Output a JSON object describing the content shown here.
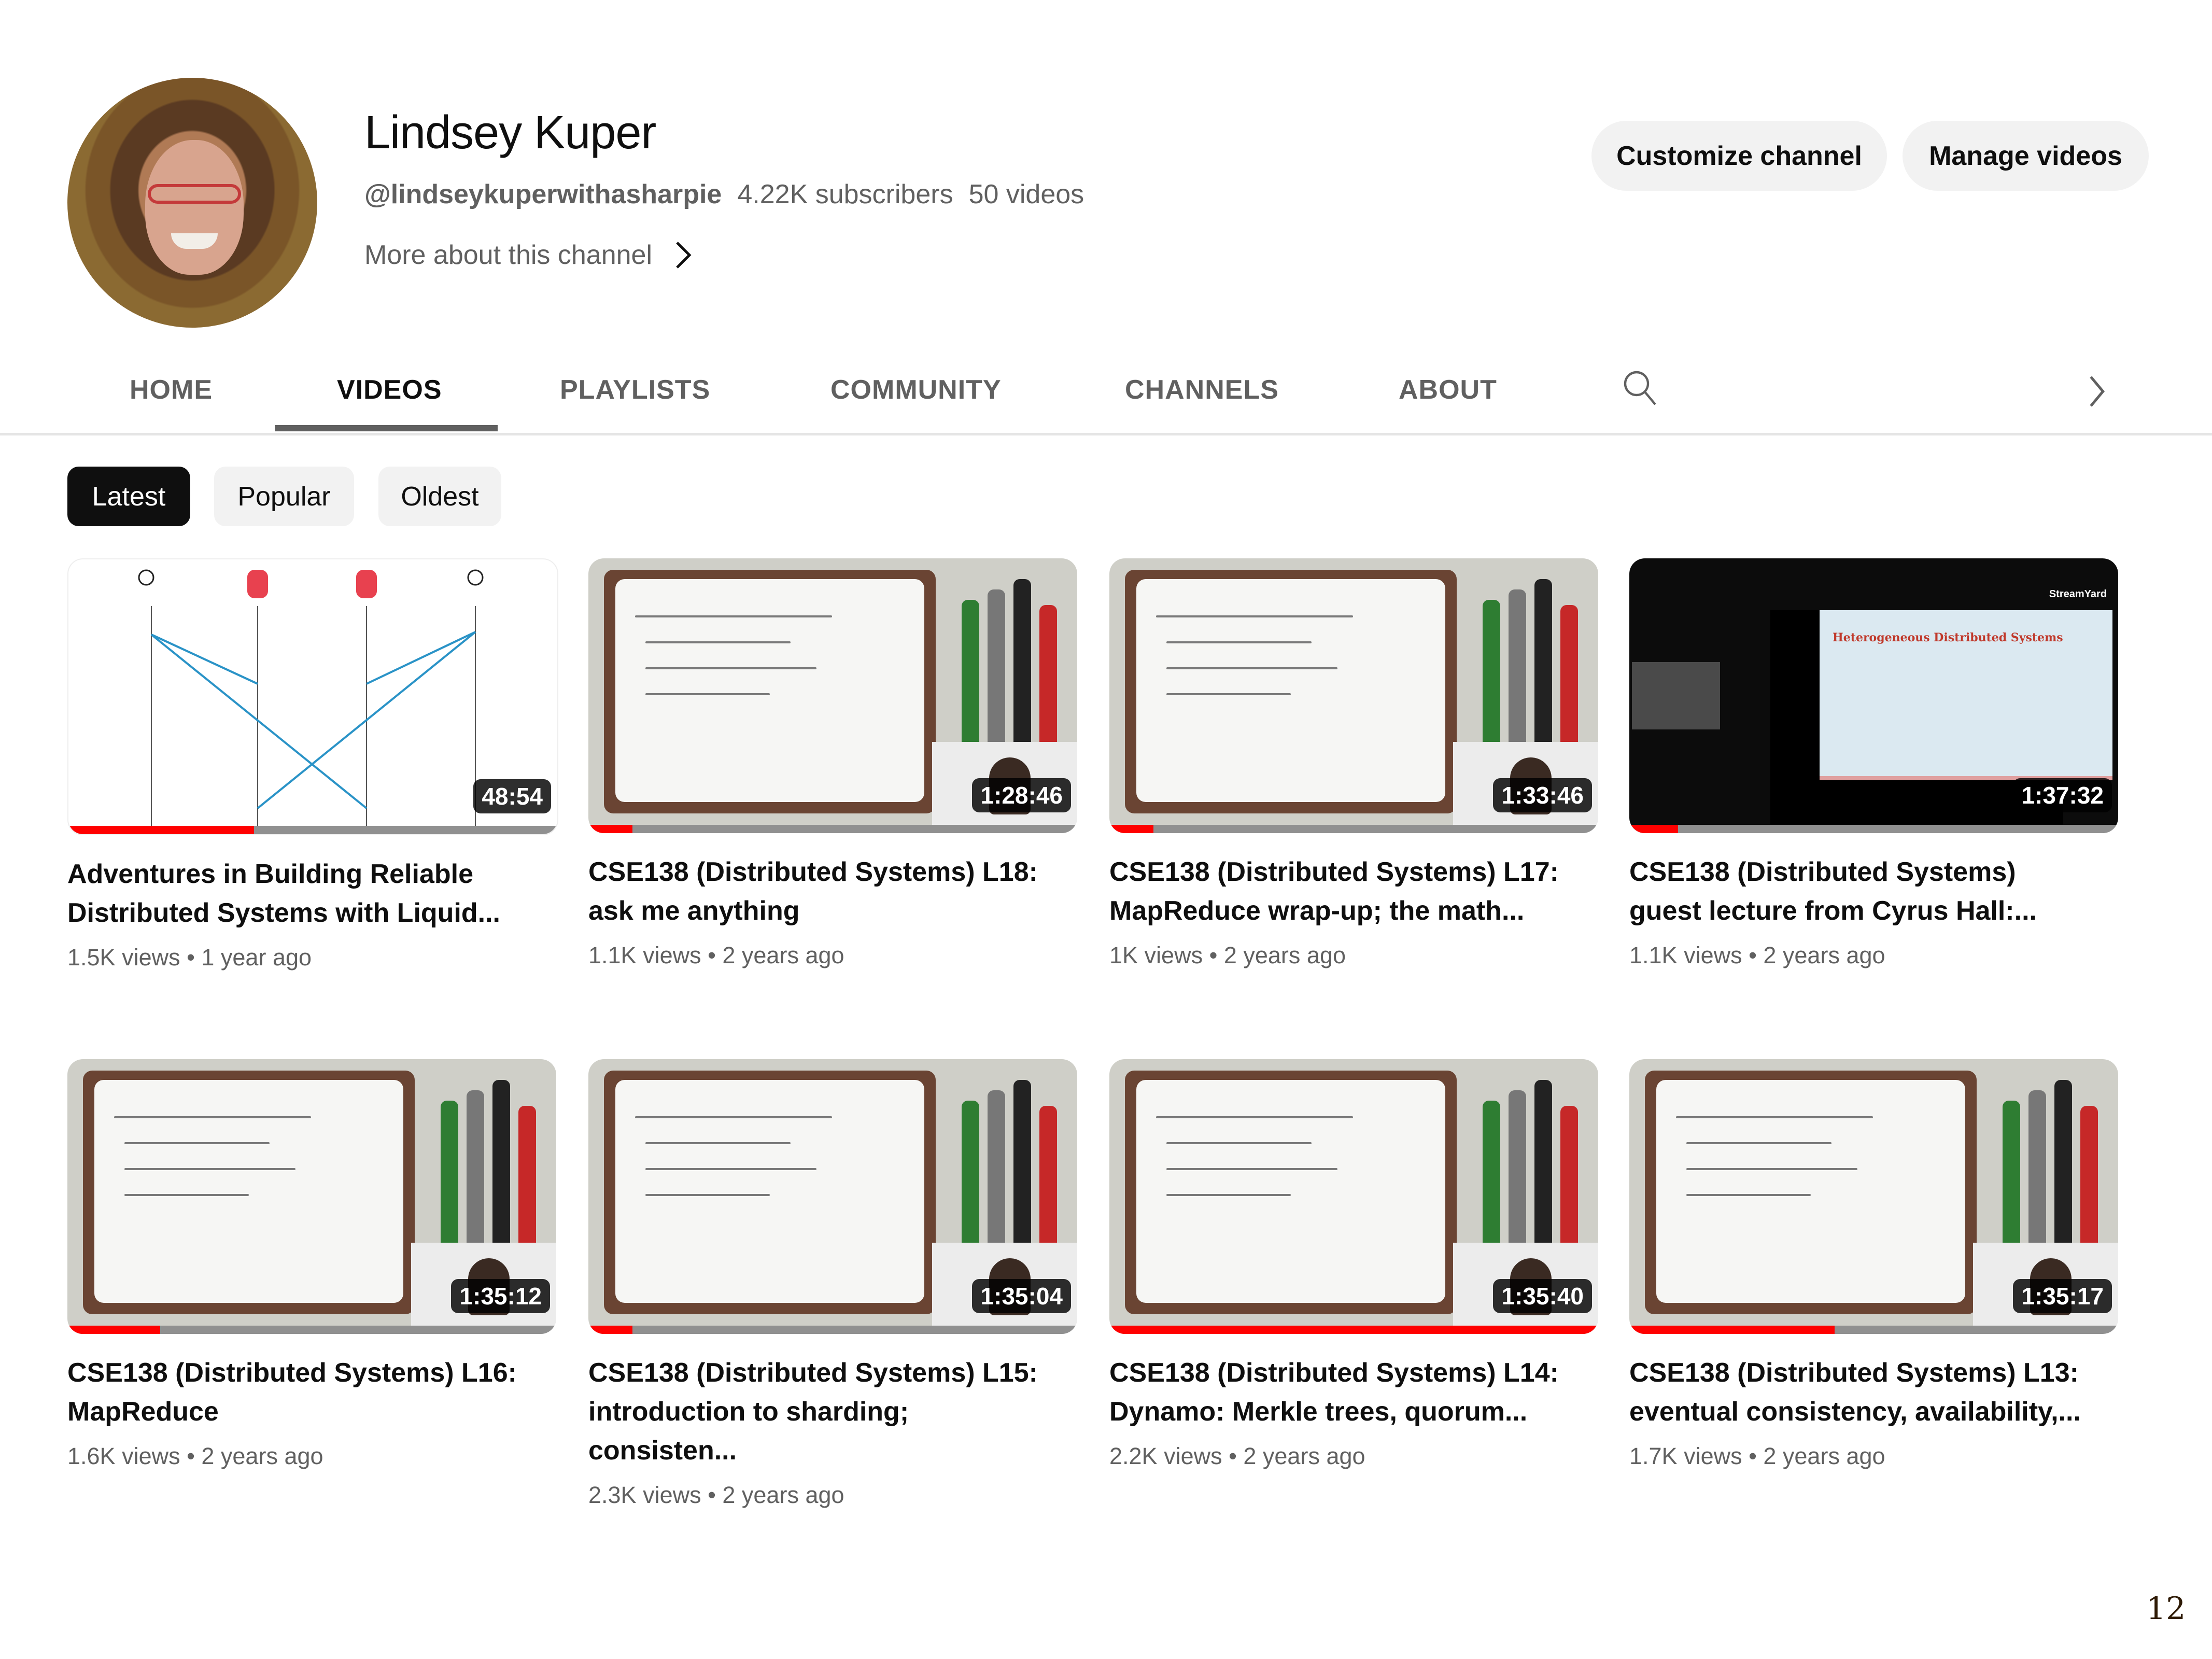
{
  "channel": {
    "name": "Lindsey Kuper",
    "handle": "@lindseykuperwithasharpie",
    "subscribers": "4.22K subscribers",
    "video_count": "50 videos",
    "more_about": "More about this channel",
    "avatar_icon": "avatar-photo"
  },
  "actions": {
    "customize": "Customize channel",
    "manage": "Manage videos"
  },
  "tabs": [
    {
      "label": "HOME",
      "active": false
    },
    {
      "label": "VIDEOS",
      "active": true
    },
    {
      "label": "PLAYLISTS",
      "active": false
    },
    {
      "label": "COMMUNITY",
      "active": false
    },
    {
      "label": "CHANNELS",
      "active": false
    },
    {
      "label": "ABOUT",
      "active": false
    }
  ],
  "tab_icons": {
    "search": "search-icon",
    "next": "chevron-right-icon"
  },
  "chips": [
    {
      "label": "Latest",
      "active": true
    },
    {
      "label": "Popular",
      "active": false
    },
    {
      "label": "Oldest",
      "active": false
    }
  ],
  "videos": [
    {
      "title_line1": "Adventures in Building Reliable",
      "title_line2": "Distributed Systems with Liquid...",
      "views": "1.5K views",
      "age": "1 year ago",
      "duration": "48:54",
      "watched": 0.38,
      "thumb": "diagram"
    },
    {
      "title_line1": "CSE138 (Distributed Systems) L18:",
      "title_line2": "ask me anything",
      "views": "1.1K views",
      "age": "2 years ago",
      "duration": "1:28:46",
      "watched": 0.09,
      "thumb": "whiteboard"
    },
    {
      "title_line1": "CSE138 (Distributed Systems) L17:",
      "title_line2": "MapReduce wrap-up; the math...",
      "views": "1K views",
      "age": "2 years ago",
      "duration": "1:33:46",
      "watched": 0.09,
      "thumb": "whiteboard"
    },
    {
      "title_line1": "CSE138 (Distributed Systems)",
      "title_line2": "guest lecture from Cyrus Hall:...",
      "views": "1.1K views",
      "age": "2 years ago",
      "duration": "1:37:32",
      "watched": 0.1,
      "thumb": "slides"
    },
    {
      "title_line1": "CSE138 (Distributed Systems) L16:",
      "title_line2": "MapReduce",
      "views": "1.6K views",
      "age": "2 years ago",
      "duration": "1:35:12",
      "watched": 0.19,
      "thumb": "whiteboard"
    },
    {
      "title_line1": "CSE138 (Distributed Systems) L15:",
      "title_line2": "introduction to sharding; consisten...",
      "views": "2.3K views",
      "age": "2 years ago",
      "duration": "1:35:04",
      "watched": 0.09,
      "thumb": "whiteboard"
    },
    {
      "title_line1": "CSE138 (Distributed Systems) L14:",
      "title_line2": "Dynamo: Merkle trees, quorum...",
      "views": "2.2K views",
      "age": "2 years ago",
      "duration": "1:35:40",
      "watched": 1.0,
      "thumb": "whiteboard"
    },
    {
      "title_line1": "CSE138 (Distributed Systems) L13:",
      "title_line2": "eventual consistency, availability,...",
      "views": "1.7K views",
      "age": "2 years ago",
      "duration": "1:35:17",
      "watched": 0.42,
      "thumb": "whiteboard"
    }
  ],
  "slide_text": {
    "heading": "Heterogeneous Distributed Systems",
    "branding": "StreamYard"
  },
  "page_number": "12",
  "colors": {
    "progress": "#ff0000",
    "chip_active": "#0f0f0f",
    "chip": "#f2f2f2",
    "secondary_text": "#606060"
  }
}
